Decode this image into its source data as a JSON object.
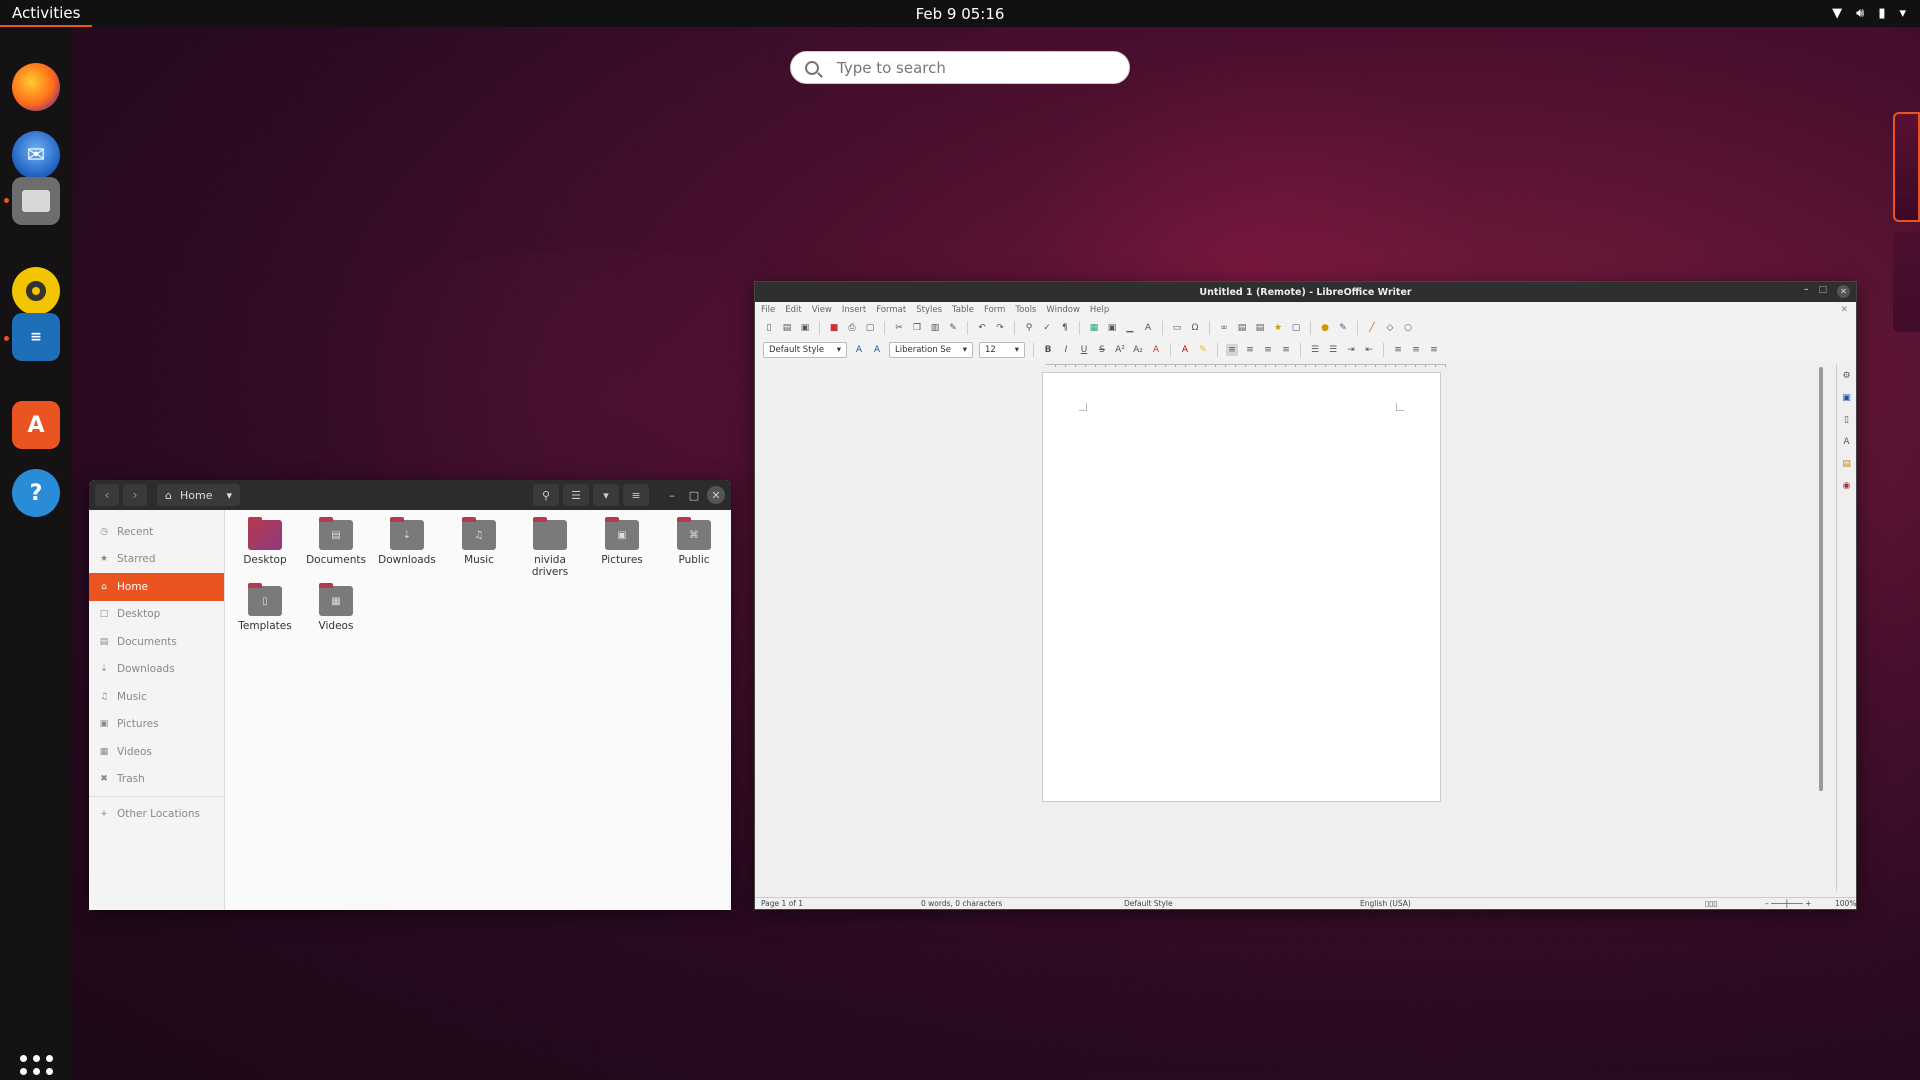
{
  "topbar": {
    "activities": "Activities",
    "clock": "Feb 9  05:16"
  },
  "search": {
    "placeholder": "Type to search"
  },
  "dock": {
    "items": [
      {
        "name": "firefox"
      },
      {
        "name": "thunderbird"
      },
      {
        "name": "files"
      },
      {
        "name": "rhythmbox"
      },
      {
        "name": "libreoffice-writer"
      },
      {
        "name": "ubuntu-software"
      },
      {
        "name": "help"
      }
    ]
  },
  "files": {
    "path": "Home",
    "sidebar": [
      "Recent",
      "Starred",
      "Home",
      "Desktop",
      "Documents",
      "Downloads",
      "Music",
      "Pictures",
      "Videos",
      "Trash",
      "Other Locations"
    ],
    "folders": [
      "Desktop",
      "Documents",
      "Downloads",
      "Music",
      "nivida drivers",
      "Pictures",
      "Public",
      "Templates",
      "Videos"
    ]
  },
  "writer": {
    "title": "Untitled 1 (Remote) - LibreOffice Writer",
    "menu": [
      "File",
      "Edit",
      "View",
      "Insert",
      "Format",
      "Styles",
      "Table",
      "Form",
      "Tools",
      "Window",
      "Help"
    ],
    "para_style": "Default Style",
    "font_name": "Liberation Se",
    "font_size": "12",
    "status": {
      "page": "Page 1 of 1",
      "words": "0 words, 0 characters",
      "style": "Default Style",
      "lang": "English (USA)",
      "zoom": "100%"
    }
  },
  "colors": {
    "accent": "#e95420",
    "topbar": "#111111"
  }
}
